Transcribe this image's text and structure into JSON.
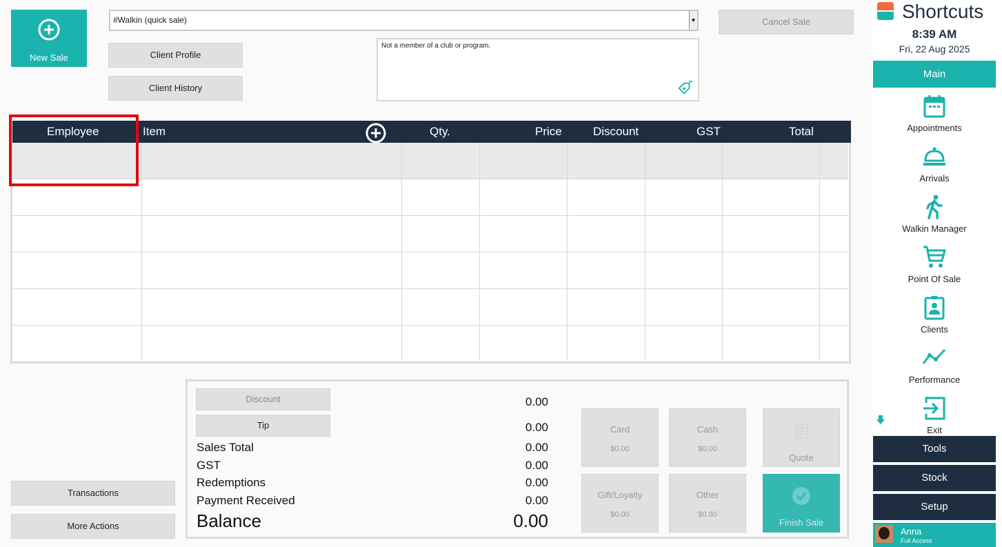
{
  "top": {
    "new_sale_label": "New Sale",
    "client_select_value": "#Walkin (quick sale)",
    "client_profile_label": "Client Profile",
    "client_history_label": "Client History",
    "cancel_sale_label": "Cancel Sale",
    "club_status": "Not a member of a club or program."
  },
  "grid": {
    "columns": [
      "Employee",
      "Item",
      "Qty.",
      "Price",
      "Discount",
      "GST",
      "Total"
    ]
  },
  "bottom_left": {
    "transactions_label": "Transactions",
    "more_actions_label": "More Actions"
  },
  "summary": {
    "discount_label": "Discount",
    "discount_value": "0.00",
    "tip_label": "Tip",
    "tip_value": "0.00",
    "sales_total_label": "Sales Total",
    "sales_total_value": "0.00",
    "gst_label": "GST",
    "gst_value": "0.00",
    "redemptions_label": "Redemptions",
    "redemptions_value": "0.00",
    "payment_received_label": "Payment Received",
    "payment_received_value": "0.00",
    "balance_label": "Balance",
    "balance_value": "0.00"
  },
  "payments": {
    "card_label": "Card",
    "card_amount": "$0.00",
    "cash_label": "Cash",
    "cash_amount": "$0.00",
    "quote_label": "Quote",
    "gift_label": "Gift/Loyalty",
    "gift_amount": "$0.00",
    "other_label": "Other",
    "other_amount": "$0.00",
    "finish_label": "Finish Sale"
  },
  "sidebar": {
    "brand": "Shortcuts",
    "time": "8:39 AM",
    "date": "Fri, 22 Aug 2025",
    "main_label": "Main",
    "items": [
      {
        "label": "Appointments",
        "icon": "calendar-icon"
      },
      {
        "label": "Arrivals",
        "icon": "bell-icon"
      },
      {
        "label": "Walkin Manager",
        "icon": "walking-person-icon"
      },
      {
        "label": "Point Of Sale",
        "icon": "cart-icon"
      },
      {
        "label": "Clients",
        "icon": "client-card-icon"
      },
      {
        "label": "Performance",
        "icon": "trend-line-icon"
      },
      {
        "label": "Exit",
        "icon": "exit-icon"
      }
    ],
    "tools_label": "Tools",
    "stock_label": "Stock",
    "setup_label": "Setup",
    "user_name": "Anna",
    "user_role": "Full Access"
  },
  "colors": {
    "accent": "#1ab3ad",
    "header_dark": "#1f2d40",
    "highlight": "#e30613"
  }
}
